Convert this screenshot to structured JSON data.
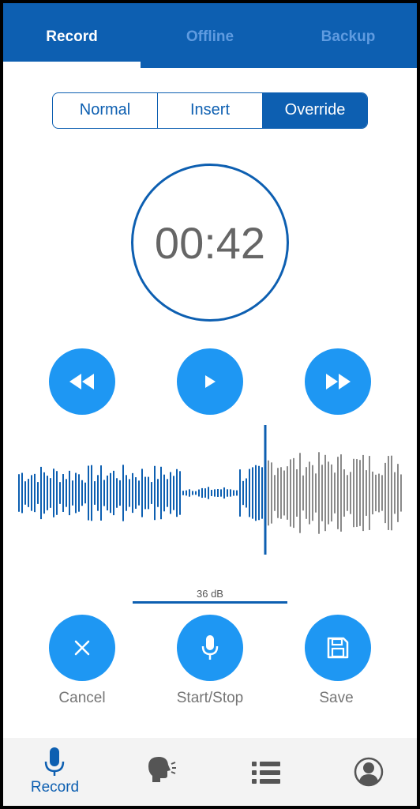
{
  "tabs": [
    {
      "label": "Record",
      "active": true
    },
    {
      "label": "Offline",
      "active": false
    },
    {
      "label": "Backup",
      "active": false
    }
  ],
  "modes": [
    {
      "label": "Normal",
      "active": false
    },
    {
      "label": "Insert",
      "active": false
    },
    {
      "label": "Override",
      "active": true
    }
  ],
  "timer": "00:42",
  "playback": {
    "rewind_icon": "rewind-icon",
    "play_icon": "play-icon",
    "forward_icon": "fast-forward-icon"
  },
  "level": {
    "label": "36 dB"
  },
  "actions": {
    "cancel": "Cancel",
    "start_stop": "Start/Stop",
    "save": "Save"
  },
  "bottom_nav": {
    "record_label": "Record",
    "icons": [
      "microphone-icon",
      "speaking-head-icon",
      "list-icon",
      "account-icon"
    ]
  },
  "colors": {
    "primary": "#0d5fb1",
    "button": "#1e97f3",
    "waveform_recorded": "#0d5fb1",
    "waveform_remaining": "#8a8a8a"
  }
}
